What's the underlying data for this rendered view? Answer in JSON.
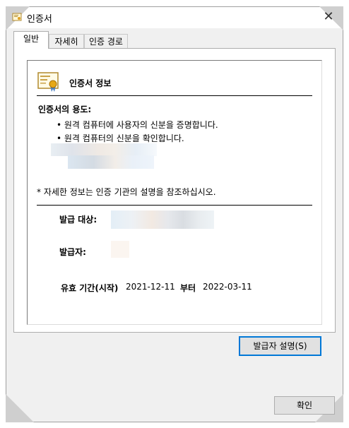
{
  "window": {
    "title": "인증서"
  },
  "tabs": [
    {
      "label": "일반",
      "active": true
    },
    {
      "label": "자세히",
      "active": false
    },
    {
      "label": "인증 경로",
      "active": false
    }
  ],
  "cert": {
    "info_title": "인증서 정보",
    "purpose_heading": "인증서의 용도:",
    "purposes": [
      "• 원격 컴퓨터에 사용자의 신분을 증명합니다.",
      "• 원격 컴퓨터의 신분을 확인합니다."
    ],
    "note": "* 자세한 정보는 인증 기관의 설명을 참조하십시오.",
    "issued_to_label": "발급 대상:",
    "issued_by_label": "발급자:",
    "validity_label": "유효 기간(시작)",
    "valid_from": "2021-12-11",
    "to_label": "부터",
    "valid_to": "2022-03-11"
  },
  "buttons": {
    "issuer_statement": "발급자 설명(S)",
    "ok": "확인"
  },
  "colors": {
    "accent": "#0078d7",
    "redacted_blur": [
      "#e6eef4",
      "#d8dde4",
      "#ece8e4",
      "#f3efe9",
      "#e3e9f2"
    ]
  },
  "icons": {
    "app": "certificate-icon",
    "close": "close-icon",
    "cert_info": "certificate-ribbon-icon"
  }
}
